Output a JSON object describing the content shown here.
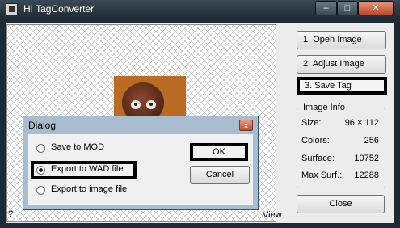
{
  "window": {
    "title": "HI TagConverter",
    "controls": {
      "minimize": "–",
      "maximize": "□",
      "close": "✕"
    }
  },
  "canvas": {
    "view_label": "View",
    "help_label": "?"
  },
  "actions": {
    "open_image": "1.  Open Image",
    "adjust_image": "2.  Adjust Image",
    "save_tag": "3.  Save Tag",
    "close": "Close"
  },
  "image_info": {
    "title": "Image Info",
    "rows": [
      {
        "label": "Size:",
        "value": "96 × 112"
      },
      {
        "label": "Colors:",
        "value": "256"
      },
      {
        "label": "Surface:",
        "value": "10752"
      },
      {
        "label": "Max Surf.:",
        "value": "12288"
      }
    ]
  },
  "dialog": {
    "title": "Dialog",
    "close_glyph": "x",
    "options": [
      {
        "label": "Save to MOD",
        "selected": false
      },
      {
        "label": "Export to WAD file",
        "selected": true
      },
      {
        "label": "Export to image file",
        "selected": false
      }
    ],
    "ok_label": "OK",
    "cancel_label": "Cancel"
  },
  "icons": [
    "app-icon",
    "minimize-icon",
    "maximize-icon",
    "close-icon",
    "dialog-close-icon"
  ],
  "colors": {
    "highlight_border": "#000000",
    "dialog_frame": "#a9bdd0",
    "close_button": "#c24a30"
  }
}
